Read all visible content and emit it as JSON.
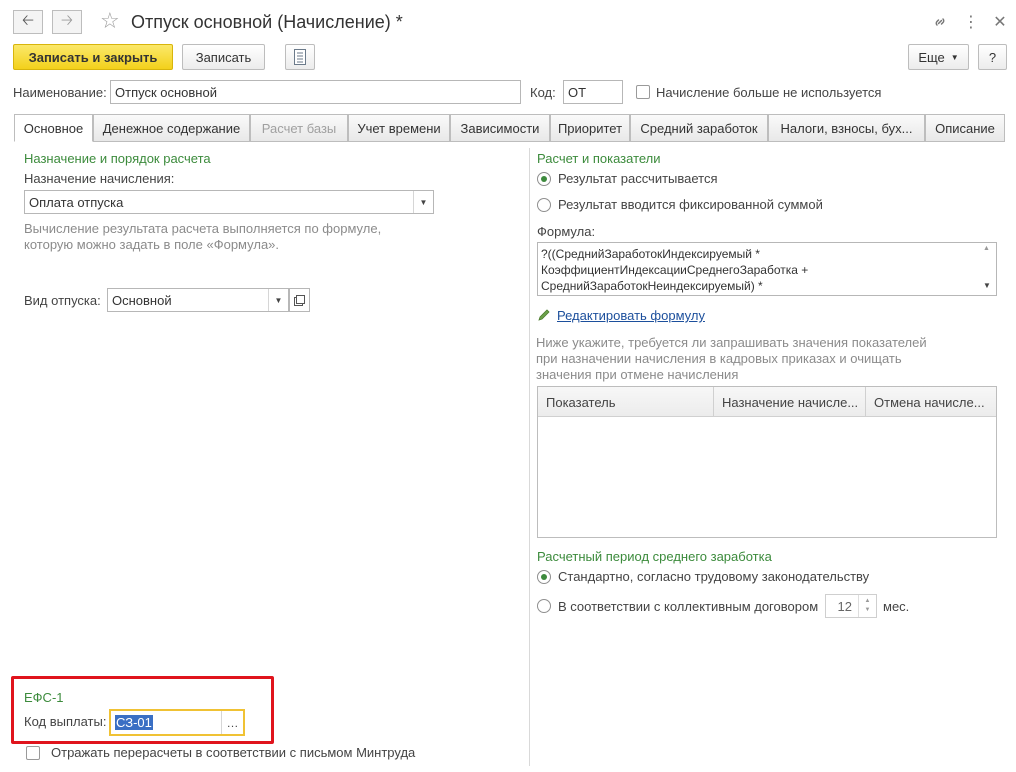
{
  "window": {
    "title": "Отпуск основной (Начисление) *",
    "icons": [
      "arrow-left-icon",
      "arrow-right-icon",
      "star-icon",
      "link-icon",
      "more-vert-icon",
      "close-icon"
    ]
  },
  "toolbar": {
    "save_close": "Записать и закрыть",
    "save": "Записать",
    "more": "Еще",
    "help": "?"
  },
  "header": {
    "name_label": "Наименование:",
    "name_value": "Отпуск основной",
    "code_label": "Код:",
    "code_value": "ОТ",
    "unused_label": "Начисление больше не используется"
  },
  "tabs": [
    {
      "label": "Основное",
      "state": "active"
    },
    {
      "label": "Денежное содержание",
      "state": "normal"
    },
    {
      "label": "Расчет базы",
      "state": "disabled"
    },
    {
      "label": "Учет времени",
      "state": "normal"
    },
    {
      "label": "Зависимости",
      "state": "normal"
    },
    {
      "label": "Приоритет",
      "state": "normal"
    },
    {
      "label": "Средний заработок",
      "state": "normal"
    },
    {
      "label": "Налоги, взносы, бух...",
      "state": "normal"
    },
    {
      "label": "Описание",
      "state": "normal"
    }
  ],
  "left": {
    "section_title": "Назначение и порядок расчета",
    "purpose_label": "Назначение начисления:",
    "purpose_value": "Оплата отпуска",
    "hint_line1": "Вычисление результата расчета выполняется по формуле,",
    "hint_line2": "которую можно задать в поле «Формула».",
    "vacation_label": "Вид отпуска:",
    "vacation_value": "Основной",
    "efs_title": "ЕФС-1",
    "payment_code_label": "Код выплаты:",
    "payment_code_value": "СЗ-01",
    "recalc_label": "Отражать перерасчеты в соответствии с письмом Минтруда"
  },
  "right": {
    "section_title": "Расчет и показатели",
    "radio_calculated": "Результат рассчитывается",
    "radio_fixed": "Результат вводится фиксированной суммой",
    "formula_label": "Формула:",
    "formula_line1": "?((СреднийЗаработокИндексируемый *",
    "formula_line2": "КоэффициентИндексацииСреднегоЗаработка +",
    "formula_line3": "СреднийЗаработокНеиндексируемый) *",
    "edit_formula": "Редактировать формулу",
    "hint_line1": "Ниже укажите, требуется ли запрашивать значения показателей",
    "hint_line2": "при назначении начисления в кадровых приказах и очищать",
    "hint_line3": "значения при отмене начисления",
    "table_columns": [
      "Показатель",
      "Назначение начисле...",
      "Отмена начисле..."
    ],
    "period_title": "Расчетный период среднего заработка",
    "radio_standard": "Стандартно, согласно трудовому законодательству",
    "radio_collective": "В соответствии с коллективным договором",
    "months_value": "12",
    "months_unit": "мес."
  },
  "colors": {
    "accent_yellow": "#f3d11b",
    "section_green": "#3c8b3c",
    "highlight_red": "#e0141d",
    "link_blue": "#1c4f9c"
  }
}
